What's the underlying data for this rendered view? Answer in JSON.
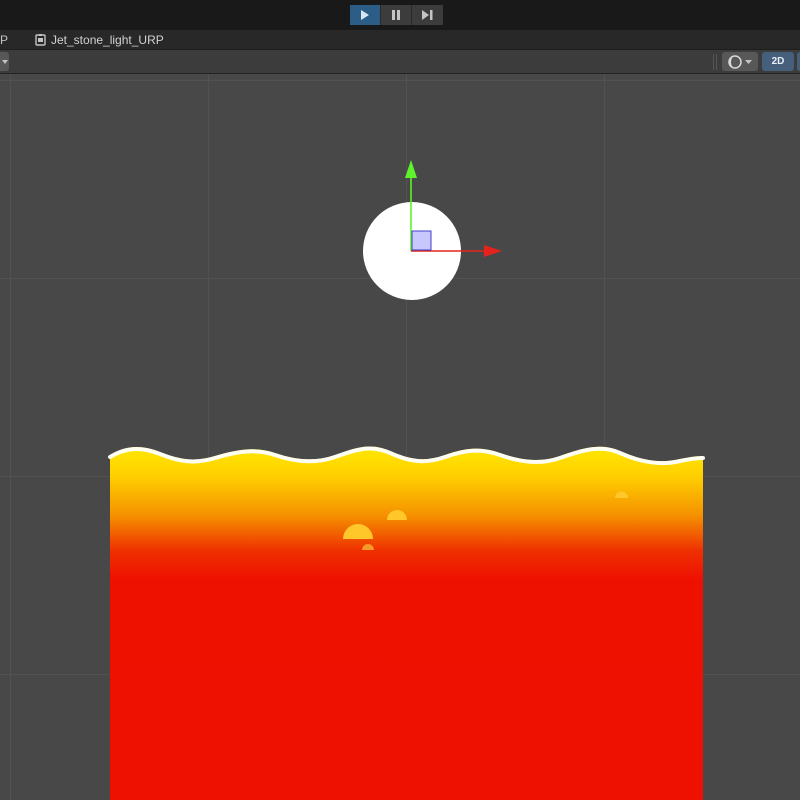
{
  "play_toolbar": {
    "buttons": [
      {
        "name": "play-button",
        "icon": "play-icon",
        "active": true
      },
      {
        "name": "pause-button",
        "icon": "pause-icon",
        "active": false
      },
      {
        "name": "step-button",
        "icon": "step-icon",
        "active": false
      }
    ]
  },
  "tabs": {
    "partial_label": "P",
    "active_label": "Jet_stone_light_URP",
    "active_icon": "prefab-icon"
  },
  "scene_toolbar": {
    "shading_icon": "shading-mode-icon",
    "mode_2d_label": "2D"
  },
  "scene": {
    "background": "#484848",
    "grid_color": "#525252",
    "lava_colors": {
      "surface": "#ffffff",
      "top": "#ffe600",
      "middle": "#f6a000",
      "bottom": "#ee1000"
    },
    "gizmo_colors": {
      "y_axis": "#5ef32b",
      "x_axis": "#e5231c",
      "center": "#c8c8ff"
    }
  }
}
